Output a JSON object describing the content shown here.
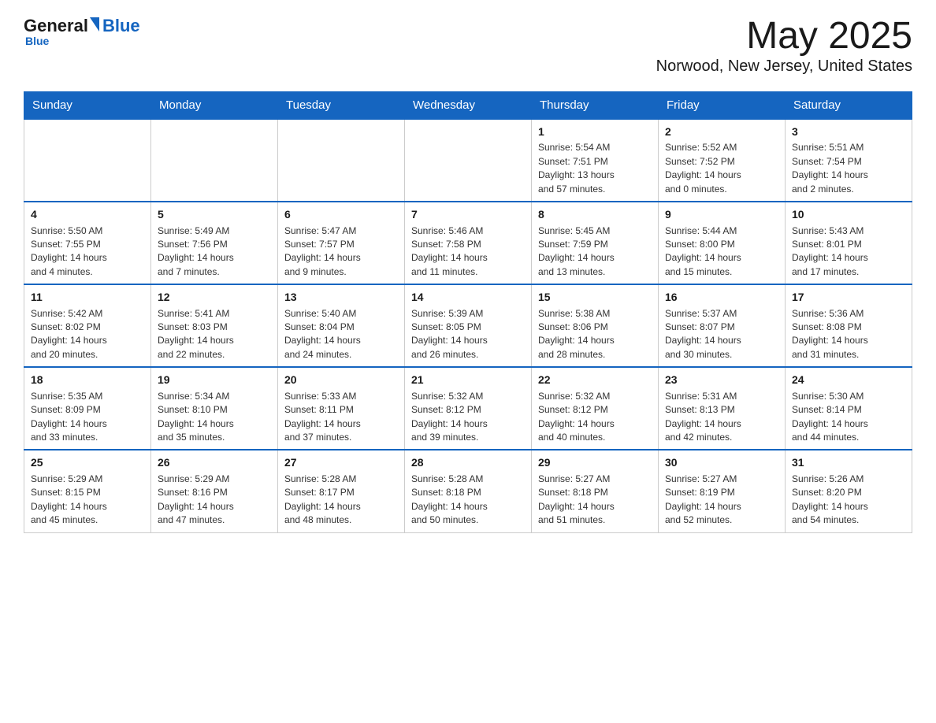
{
  "header": {
    "logo": {
      "general": "General",
      "blue": "Blue",
      "subtitle": "Blue"
    },
    "title": "May 2025",
    "location": "Norwood, New Jersey, United States"
  },
  "calendar": {
    "days_of_week": [
      "Sunday",
      "Monday",
      "Tuesday",
      "Wednesday",
      "Thursday",
      "Friday",
      "Saturday"
    ],
    "weeks": [
      [
        {
          "day": "",
          "info": ""
        },
        {
          "day": "",
          "info": ""
        },
        {
          "day": "",
          "info": ""
        },
        {
          "day": "",
          "info": ""
        },
        {
          "day": "1",
          "info": "Sunrise: 5:54 AM\nSunset: 7:51 PM\nDaylight: 13 hours\nand 57 minutes."
        },
        {
          "day": "2",
          "info": "Sunrise: 5:52 AM\nSunset: 7:52 PM\nDaylight: 14 hours\nand 0 minutes."
        },
        {
          "day": "3",
          "info": "Sunrise: 5:51 AM\nSunset: 7:54 PM\nDaylight: 14 hours\nand 2 minutes."
        }
      ],
      [
        {
          "day": "4",
          "info": "Sunrise: 5:50 AM\nSunset: 7:55 PM\nDaylight: 14 hours\nand 4 minutes."
        },
        {
          "day": "5",
          "info": "Sunrise: 5:49 AM\nSunset: 7:56 PM\nDaylight: 14 hours\nand 7 minutes."
        },
        {
          "day": "6",
          "info": "Sunrise: 5:47 AM\nSunset: 7:57 PM\nDaylight: 14 hours\nand 9 minutes."
        },
        {
          "day": "7",
          "info": "Sunrise: 5:46 AM\nSunset: 7:58 PM\nDaylight: 14 hours\nand 11 minutes."
        },
        {
          "day": "8",
          "info": "Sunrise: 5:45 AM\nSunset: 7:59 PM\nDaylight: 14 hours\nand 13 minutes."
        },
        {
          "day": "9",
          "info": "Sunrise: 5:44 AM\nSunset: 8:00 PM\nDaylight: 14 hours\nand 15 minutes."
        },
        {
          "day": "10",
          "info": "Sunrise: 5:43 AM\nSunset: 8:01 PM\nDaylight: 14 hours\nand 17 minutes."
        }
      ],
      [
        {
          "day": "11",
          "info": "Sunrise: 5:42 AM\nSunset: 8:02 PM\nDaylight: 14 hours\nand 20 minutes."
        },
        {
          "day": "12",
          "info": "Sunrise: 5:41 AM\nSunset: 8:03 PM\nDaylight: 14 hours\nand 22 minutes."
        },
        {
          "day": "13",
          "info": "Sunrise: 5:40 AM\nSunset: 8:04 PM\nDaylight: 14 hours\nand 24 minutes."
        },
        {
          "day": "14",
          "info": "Sunrise: 5:39 AM\nSunset: 8:05 PM\nDaylight: 14 hours\nand 26 minutes."
        },
        {
          "day": "15",
          "info": "Sunrise: 5:38 AM\nSunset: 8:06 PM\nDaylight: 14 hours\nand 28 minutes."
        },
        {
          "day": "16",
          "info": "Sunrise: 5:37 AM\nSunset: 8:07 PM\nDaylight: 14 hours\nand 30 minutes."
        },
        {
          "day": "17",
          "info": "Sunrise: 5:36 AM\nSunset: 8:08 PM\nDaylight: 14 hours\nand 31 minutes."
        }
      ],
      [
        {
          "day": "18",
          "info": "Sunrise: 5:35 AM\nSunset: 8:09 PM\nDaylight: 14 hours\nand 33 minutes."
        },
        {
          "day": "19",
          "info": "Sunrise: 5:34 AM\nSunset: 8:10 PM\nDaylight: 14 hours\nand 35 minutes."
        },
        {
          "day": "20",
          "info": "Sunrise: 5:33 AM\nSunset: 8:11 PM\nDaylight: 14 hours\nand 37 minutes."
        },
        {
          "day": "21",
          "info": "Sunrise: 5:32 AM\nSunset: 8:12 PM\nDaylight: 14 hours\nand 39 minutes."
        },
        {
          "day": "22",
          "info": "Sunrise: 5:32 AM\nSunset: 8:12 PM\nDaylight: 14 hours\nand 40 minutes."
        },
        {
          "day": "23",
          "info": "Sunrise: 5:31 AM\nSunset: 8:13 PM\nDaylight: 14 hours\nand 42 minutes."
        },
        {
          "day": "24",
          "info": "Sunrise: 5:30 AM\nSunset: 8:14 PM\nDaylight: 14 hours\nand 44 minutes."
        }
      ],
      [
        {
          "day": "25",
          "info": "Sunrise: 5:29 AM\nSunset: 8:15 PM\nDaylight: 14 hours\nand 45 minutes."
        },
        {
          "day": "26",
          "info": "Sunrise: 5:29 AM\nSunset: 8:16 PM\nDaylight: 14 hours\nand 47 minutes."
        },
        {
          "day": "27",
          "info": "Sunrise: 5:28 AM\nSunset: 8:17 PM\nDaylight: 14 hours\nand 48 minutes."
        },
        {
          "day": "28",
          "info": "Sunrise: 5:28 AM\nSunset: 8:18 PM\nDaylight: 14 hours\nand 50 minutes."
        },
        {
          "day": "29",
          "info": "Sunrise: 5:27 AM\nSunset: 8:18 PM\nDaylight: 14 hours\nand 51 minutes."
        },
        {
          "day": "30",
          "info": "Sunrise: 5:27 AM\nSunset: 8:19 PM\nDaylight: 14 hours\nand 52 minutes."
        },
        {
          "day": "31",
          "info": "Sunrise: 5:26 AM\nSunset: 8:20 PM\nDaylight: 14 hours\nand 54 minutes."
        }
      ]
    ]
  }
}
